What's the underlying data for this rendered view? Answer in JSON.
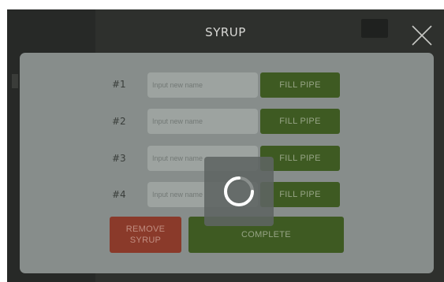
{
  "header": {
    "title": "SYRUP"
  },
  "rows": [
    {
      "label": "#1",
      "placeholder": "Input new name",
      "fill_label": "FILL PIPE"
    },
    {
      "label": "#2",
      "placeholder": "Input new name",
      "fill_label": "FILL PIPE"
    },
    {
      "label": "#3",
      "placeholder": "Input new name",
      "fill_label": "FILL PIPE"
    },
    {
      "label": "#4",
      "placeholder": "Input new name",
      "fill_label": "FILL PIPE"
    }
  ],
  "actions": {
    "remove_line1": "REMOVE",
    "remove_line2": "SYRUP",
    "complete_label": "COMPLETE"
  },
  "icons": {
    "close": "close-icon",
    "spinner": "spinner-icon"
  },
  "colors": {
    "modal_bg": "#878d8b",
    "fill_button": "#3e5a22",
    "remove_button": "#8a3a2a",
    "screen_bg": "#2e302d"
  }
}
